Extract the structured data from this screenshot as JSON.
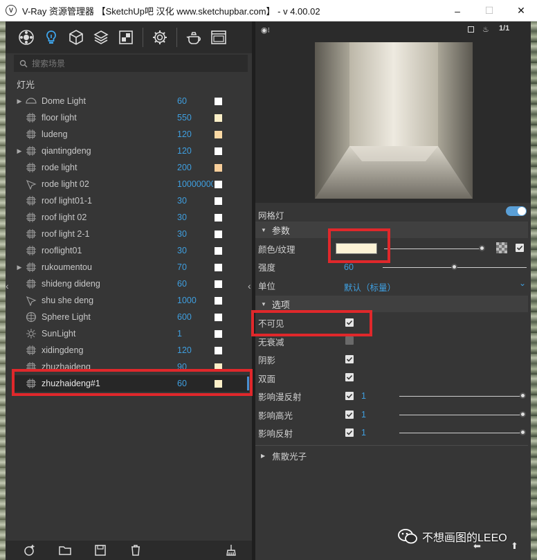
{
  "window": {
    "title": "V-Ray 资源管理器 【SketchUp吧 汉化 www.sketchupbar.com】 - v 4.00.02",
    "logo_letter": "V",
    "controls": [
      "–",
      "☐",
      "✕"
    ]
  },
  "toolbar": {
    "icons": [
      "materials-icon",
      "lights-icon",
      "geometry-icon",
      "layers-icon",
      "render-elements-icon",
      "settings-icon",
      "teapot-render-icon",
      "frame-buffer-icon"
    ]
  },
  "search": {
    "placeholder": "搜索场景"
  },
  "section": {
    "label": "灯光"
  },
  "lights": [
    {
      "name": "Dome Light",
      "value": "60",
      "color": "#ffffff",
      "icon": "dome-light-icon",
      "expandable": true
    },
    {
      "name": "floor light",
      "value": "550",
      "color": "#fdf0c8",
      "icon": "rect-light-icon",
      "expandable": false
    },
    {
      "name": "ludeng",
      "value": "120",
      "color": "#fbd9a4",
      "icon": "rect-light-icon",
      "expandable": false
    },
    {
      "name": "qiantingdeng",
      "value": "120",
      "color": "#ffffff",
      "icon": "rect-light-icon",
      "expandable": true
    },
    {
      "name": "rode light",
      "value": "200",
      "color": "#f9cf9b",
      "icon": "rect-light-icon",
      "expandable": false
    },
    {
      "name": "rode light 02",
      "value": "10000000",
      "color": "#ffffff",
      "icon": "spot-light-icon",
      "expandable": false
    },
    {
      "name": "roof light01-1",
      "value": "30",
      "color": "#ffffff",
      "icon": "rect-light-icon",
      "expandable": false
    },
    {
      "name": "roof light 02",
      "value": "30",
      "color": "#ffffff",
      "icon": "rect-light-icon",
      "expandable": false
    },
    {
      "name": "roof light 2-1",
      "value": "30",
      "color": "#ffffff",
      "icon": "rect-light-icon",
      "expandable": false
    },
    {
      "name": "rooflight01",
      "value": "30",
      "color": "#ffffff",
      "icon": "rect-light-icon",
      "expandable": false
    },
    {
      "name": "rukoumentou",
      "value": "70",
      "color": "#ffffff",
      "icon": "rect-light-icon",
      "expandable": true
    },
    {
      "name": "shideng dideng",
      "value": "60",
      "color": "#ffffff",
      "icon": "rect-light-icon",
      "expandable": false
    },
    {
      "name": "shu she deng",
      "value": "1000",
      "color": "#ffffff",
      "icon": "spot-light-icon",
      "expandable": false
    },
    {
      "name": "Sphere Light",
      "value": "600",
      "color": "#ffffff",
      "icon": "sphere-light-icon",
      "expandable": false
    },
    {
      "name": "SunLight",
      "value": "1",
      "color": "#ffffff",
      "icon": "sun-light-icon",
      "expandable": false
    },
    {
      "name": "xidingdeng",
      "value": "120",
      "color": "#ffffff",
      "icon": "rect-light-icon",
      "expandable": false
    },
    {
      "name": "zhuzhaideng",
      "value": "90",
      "color": "#fdf0c8",
      "icon": "rect-light-icon",
      "expandable": false
    },
    {
      "name": "zhuzhaideng#1",
      "value": "60",
      "color": "#fdf0c8",
      "icon": "rect-light-icon",
      "expandable": false,
      "selected": true
    }
  ],
  "preview": {
    "count_label": "1/1"
  },
  "properties": {
    "header": "网格灯",
    "enabled": true,
    "params_group": "参数",
    "color_label": "颜色/纹理",
    "color_swatch": "#fdf3d6",
    "intensity_label": "强度",
    "intensity_value": "60",
    "unit_label": "单位",
    "unit_value": "默认（标量）",
    "options_group": "选项",
    "invisible_label": "不可见",
    "no_decay_label": "无衰减",
    "shadows_label": "阴影",
    "double_sided_label": "双面",
    "affect_diffuse_label": "影响漫反射",
    "affect_diffuse_value": "1",
    "affect_specular_label": "影响高光",
    "affect_specular_value": "1",
    "affect_reflections_label": "影响反射",
    "affect_reflections_value": "1",
    "caustics_group": "焦散光子"
  },
  "watermark": {
    "text": "不想画图的LEEO"
  }
}
